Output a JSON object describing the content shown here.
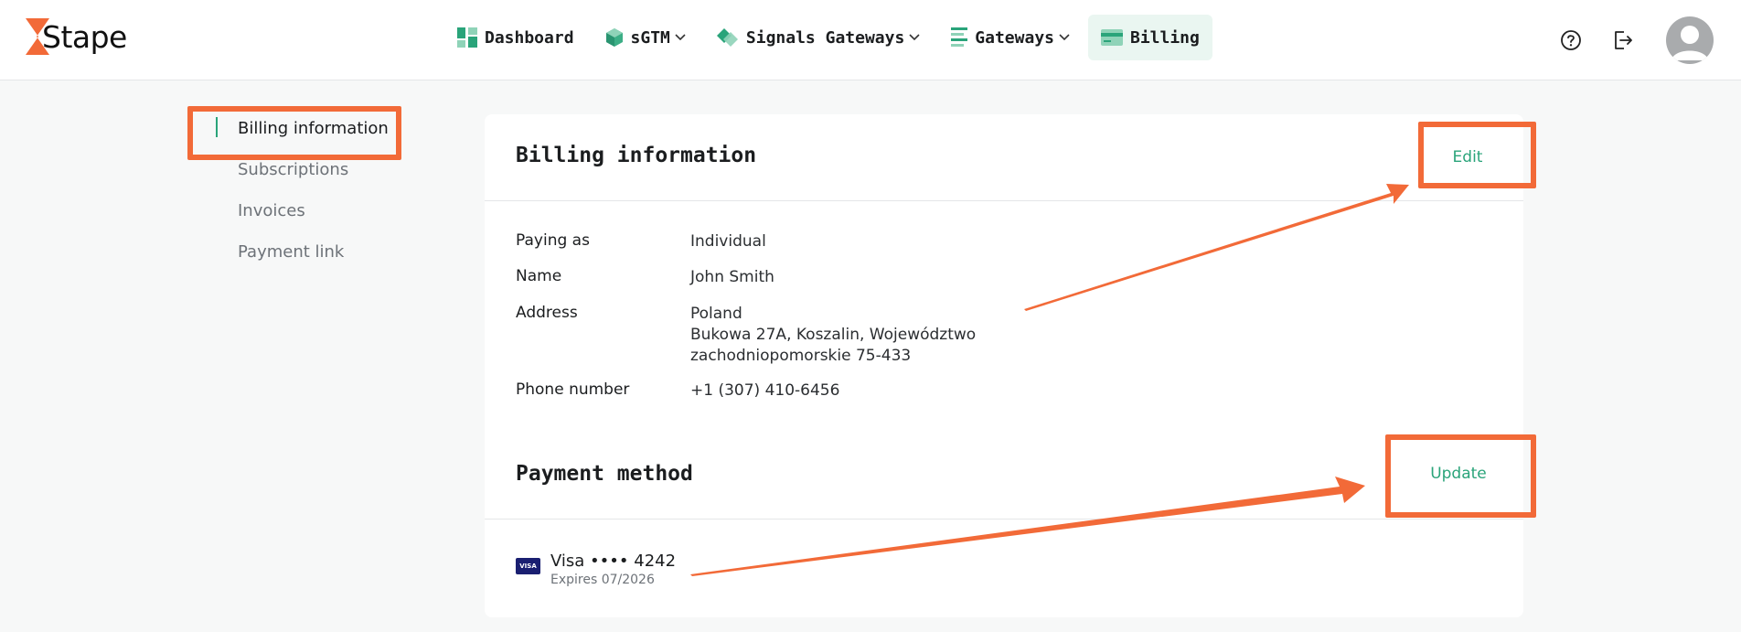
{
  "header": {
    "logo_text": "Stape",
    "nav": [
      {
        "label": "Dashboard",
        "icon": "dashboard-icon",
        "dropdown": false,
        "active": false
      },
      {
        "label": "sGTM",
        "icon": "cube-icon",
        "dropdown": true,
        "active": false
      },
      {
        "label": "Signals Gateways",
        "icon": "diamond-icon",
        "dropdown": true,
        "active": false
      },
      {
        "label": "Gateways",
        "icon": "list-icon",
        "dropdown": true,
        "active": false
      },
      {
        "label": "Billing",
        "icon": "credit-card-icon",
        "dropdown": false,
        "active": true
      }
    ],
    "icons": [
      "help-icon",
      "logout-icon",
      "avatar"
    ]
  },
  "sidebar": {
    "items": [
      {
        "label": "Billing information",
        "active": true
      },
      {
        "label": "Subscriptions",
        "active": false
      },
      {
        "label": "Invoices",
        "active": false
      },
      {
        "label": "Payment link",
        "active": false
      }
    ]
  },
  "billing": {
    "title": "Billing information",
    "edit_label": "Edit",
    "fields": {
      "paying_as": {
        "label": "Paying as",
        "value": "Individual"
      },
      "name": {
        "label": "Name",
        "value": "John Smith"
      },
      "address": {
        "label": "Address",
        "lines": [
          "Poland",
          "Bukowa 27A, Koszalin, Województwo",
          "zachodniopomorskie 75-433"
        ]
      },
      "phone": {
        "label": "Phone number",
        "value": "+1 (307) 410-6456"
      }
    }
  },
  "payment": {
    "title": "Payment method",
    "update_label": "Update",
    "card_brand_badge": "VISA",
    "card_number": "Visa •••• 4242",
    "expires": "Expires 07/2026"
  },
  "colors": {
    "accent": "#2aa47a",
    "annotation": "#f26a38",
    "nav_active_bg": "#eaf6f1"
  }
}
